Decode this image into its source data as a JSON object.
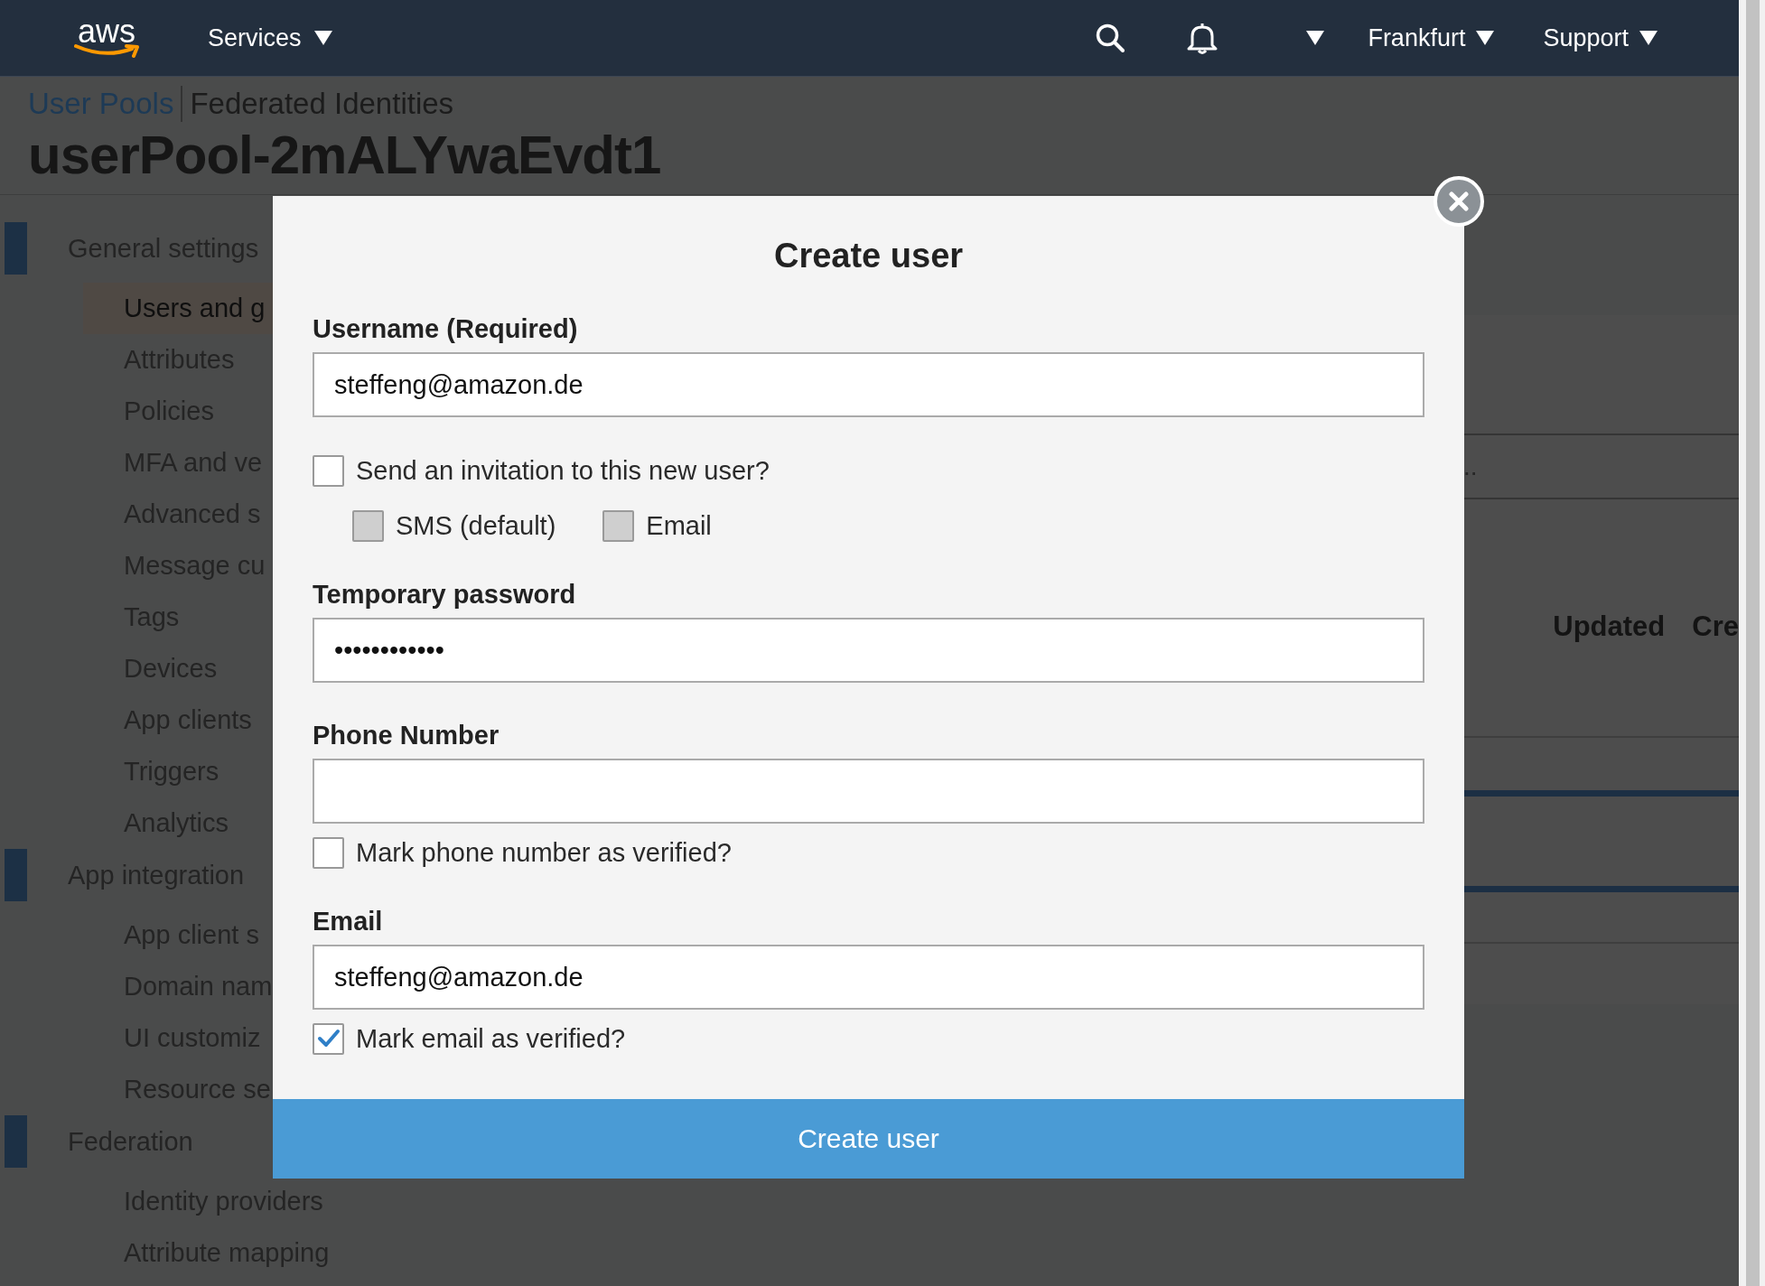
{
  "top_nav": {
    "logo": "aws",
    "left_items": [
      {
        "kind": "menu",
        "label": "Services"
      }
    ],
    "right_items": [
      {
        "kind": "search"
      },
      {
        "kind": "bell"
      },
      {
        "kind": "menu"
      },
      {
        "kind": "menu",
        "label": "Frankfurt"
      },
      {
        "kind": "menu",
        "label": "Support"
      }
    ]
  },
  "breadcrumb": [
    {
      "label": "User Pools",
      "selected": true
    },
    {
      "label": "Federated Identities",
      "selected": false
    }
  ],
  "title": "userPool-2mALYwaEvdt1",
  "sidebar": {
    "groups": [
      {
        "label": "General settings",
        "children": [
          {
            "label": "Users and g",
            "selected": true
          },
          {
            "label": "Attributes",
            "selected": false
          },
          {
            "label": "Policies",
            "selected": false
          },
          {
            "label": "MFA and ve",
            "selected": false
          },
          {
            "label": "Advanced s",
            "selected": false
          },
          {
            "label": "Message cu",
            "selected": false
          },
          {
            "label": "Tags",
            "selected": false
          },
          {
            "label": "Devices",
            "selected": false
          },
          {
            "label": "App clients",
            "selected": false
          },
          {
            "label": "Triggers",
            "selected": false
          },
          {
            "label": "Analytics",
            "selected": false
          }
        ]
      },
      {
        "label": "App integration",
        "children": [
          {
            "label": "App client s",
            "selected": false
          },
          {
            "label": "Domain nam",
            "selected": false
          },
          {
            "label": "UI customiz",
            "selected": false
          },
          {
            "label": "Resource se",
            "selected": false
          }
        ]
      },
      {
        "label": "Federation",
        "children": [
          {
            "label": "Identity providers",
            "selected": false
          },
          {
            "label": "Attribute mapping",
            "selected": false
          }
        ]
      }
    ]
  },
  "main": {
    "text_fragment": "..",
    "column_headers": [
      "Updated",
      "Cre"
    ]
  },
  "modal": {
    "title": "Create user",
    "items": [
      {
        "kind": "field",
        "label": "Username (Required)",
        "value": "steffeng@amazon.de"
      },
      {
        "kind": "checkbox",
        "label": "Send an invitation to this new user?",
        "checked": false,
        "options": [
          {
            "label": "SMS (default)",
            "checked": false,
            "disabled": true
          },
          {
            "label": "Email",
            "checked": false,
            "disabled": true
          }
        ]
      },
      {
        "kind": "field",
        "label": "Temporary password",
        "value": "••••••••••••"
      },
      {
        "kind": "field",
        "label": "Phone Number",
        "verify": {
          "label": "Mark phone number as verified?",
          "checked": false
        }
      },
      {
        "kind": "field",
        "label": "Email",
        "value": "steffeng@amazon.de",
        "verify": {
          "label": "Mark email as verified?",
          "checked": true
        }
      }
    ],
    "submit": "Create user"
  }
}
